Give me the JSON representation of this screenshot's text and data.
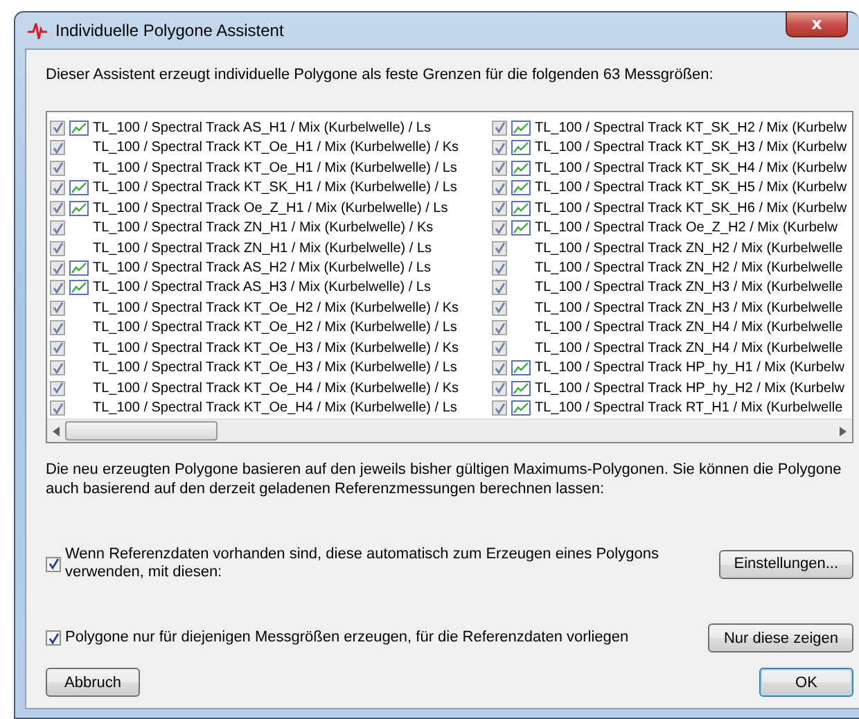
{
  "window": {
    "title": "Individuelle Polygone Assistent",
    "close": "x"
  },
  "intro": "Dieser Assistent erzeugt individuelle Polygone als feste Grenzen für die folgenden 63 Messgrößen:",
  "list": {
    "columns": [
      {
        "items": [
          {
            "label": "TL_100 / Spectral Track AS_H1 / Mix (Kurbelwelle) / Ls",
            "checked": true,
            "has_reference": true
          },
          {
            "label": "TL_100 / Spectral Track KT_Oe_H1 / Mix (Kurbelwelle) / Ks",
            "checked": true,
            "has_reference": false
          },
          {
            "label": "TL_100 / Spectral Track KT_Oe_H1 / Mix (Kurbelwelle) / Ls",
            "checked": true,
            "has_reference": false
          },
          {
            "label": "TL_100 / Spectral Track KT_SK_H1 / Mix (Kurbelwelle) / Ls",
            "checked": true,
            "has_reference": true
          },
          {
            "label": "TL_100 / Spectral Track Oe_Z_H1 / Mix (Kurbelwelle) / Ls",
            "checked": true,
            "has_reference": true
          },
          {
            "label": "TL_100 / Spectral Track ZN_H1 / Mix (Kurbelwelle) / Ks",
            "checked": true,
            "has_reference": false
          },
          {
            "label": "TL_100 / Spectral Track ZN_H1 / Mix (Kurbelwelle) / Ls",
            "checked": true,
            "has_reference": false
          },
          {
            "label": "TL_100 / Spectral Track AS_H2 / Mix (Kurbelwelle) / Ls",
            "checked": true,
            "has_reference": true
          },
          {
            "label": "TL_100 / Spectral Track AS_H3 / Mix (Kurbelwelle) / Ls",
            "checked": true,
            "has_reference": true
          },
          {
            "label": "TL_100 / Spectral Track KT_Oe_H2 / Mix (Kurbelwelle) / Ks",
            "checked": true,
            "has_reference": false
          },
          {
            "label": "TL_100 / Spectral Track KT_Oe_H2 / Mix (Kurbelwelle) / Ls",
            "checked": true,
            "has_reference": false
          },
          {
            "label": "TL_100 / Spectral Track KT_Oe_H3 / Mix (Kurbelwelle) / Ks",
            "checked": true,
            "has_reference": false
          },
          {
            "label": "TL_100 / Spectral Track KT_Oe_H3 / Mix (Kurbelwelle) / Ls",
            "checked": true,
            "has_reference": false
          },
          {
            "label": "TL_100 / Spectral Track KT_Oe_H4 / Mix (Kurbelwelle) / Ks",
            "checked": true,
            "has_reference": false
          },
          {
            "label": "TL_100 / Spectral Track KT_Oe_H4 / Mix (Kurbelwelle) / Ls",
            "checked": true,
            "has_reference": false
          }
        ]
      },
      {
        "items": [
          {
            "label": "TL_100 / Spectral Track KT_SK_H2 / Mix (Kurbelw",
            "checked": true,
            "has_reference": true
          },
          {
            "label": "TL_100 / Spectral Track KT_SK_H3 / Mix (Kurbelw",
            "checked": true,
            "has_reference": true
          },
          {
            "label": "TL_100 / Spectral Track KT_SK_H4 / Mix (Kurbelw",
            "checked": true,
            "has_reference": true
          },
          {
            "label": "TL_100 / Spectral Track KT_SK_H5 / Mix (Kurbelw",
            "checked": true,
            "has_reference": true
          },
          {
            "label": "TL_100 / Spectral Track KT_SK_H6 / Mix (Kurbelw",
            "checked": true,
            "has_reference": true
          },
          {
            "label": "TL_100 / Spectral Track Oe_Z_H2 / Mix (Kurbelw",
            "checked": true,
            "has_reference": true
          },
          {
            "label": "TL_100 / Spectral Track ZN_H2 / Mix (Kurbelwelle",
            "checked": true,
            "has_reference": false
          },
          {
            "label": "TL_100 / Spectral Track ZN_H2 / Mix (Kurbelwelle",
            "checked": true,
            "has_reference": false
          },
          {
            "label": "TL_100 / Spectral Track ZN_H3 / Mix (Kurbelwelle",
            "checked": true,
            "has_reference": false
          },
          {
            "label": "TL_100 / Spectral Track ZN_H3 / Mix (Kurbelwelle",
            "checked": true,
            "has_reference": false
          },
          {
            "label": "TL_100 / Spectral Track ZN_H4 / Mix (Kurbelwelle",
            "checked": true,
            "has_reference": false
          },
          {
            "label": "TL_100 / Spectral Track ZN_H4 / Mix (Kurbelwelle",
            "checked": true,
            "has_reference": false
          },
          {
            "label": "TL_100 / Spectral Track HP_hy_H1 / Mix (Kurbelw",
            "checked": true,
            "has_reference": true
          },
          {
            "label": "TL_100 / Spectral Track HP_hy_H2 / Mix (Kurbelw",
            "checked": true,
            "has_reference": true
          },
          {
            "label": "TL_100 / Spectral Track RT_H1 / Mix (Kurbelwelle",
            "checked": true,
            "has_reference": true
          }
        ]
      }
    ]
  },
  "note": "Die neu erzeugten Polygone basieren auf den jeweils bisher gültigen Maximums-Polygonen. Sie können die Polygone auch basierend auf den derzeit geladenen Referenzmessungen berechnen lassen:",
  "options": [
    {
      "label": "Wenn Referenzdaten vorhanden sind, diese automatisch zum Erzeugen eines Polygons verwenden, mit diesen:",
      "checked": true,
      "button": "Einstellungen..."
    },
    {
      "label": "Polygone nur für diejenigen Messgrößen erzeugen, für die Referenzdaten vorliegen",
      "checked": true,
      "button": "Nur diese zeigen"
    }
  ],
  "buttons": {
    "cancel": "Abbruch",
    "ok": "OK"
  }
}
